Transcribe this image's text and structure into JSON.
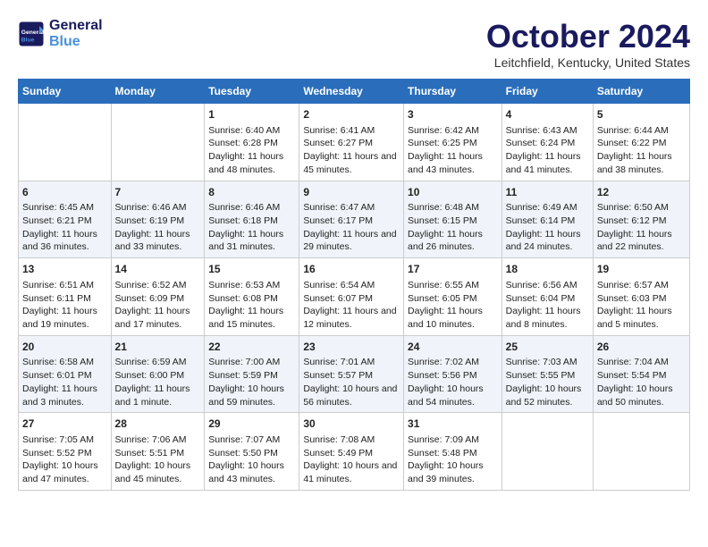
{
  "header": {
    "logo_line1": "General",
    "logo_line2": "Blue",
    "month_title": "October 2024",
    "location": "Leitchfield, Kentucky, United States"
  },
  "days_of_week": [
    "Sunday",
    "Monday",
    "Tuesday",
    "Wednesday",
    "Thursday",
    "Friday",
    "Saturday"
  ],
  "weeks": [
    [
      {
        "day": "",
        "sunrise": "",
        "sunset": "",
        "daylight": ""
      },
      {
        "day": "",
        "sunrise": "",
        "sunset": "",
        "daylight": ""
      },
      {
        "day": "1",
        "sunrise": "Sunrise: 6:40 AM",
        "sunset": "Sunset: 6:28 PM",
        "daylight": "Daylight: 11 hours and 48 minutes."
      },
      {
        "day": "2",
        "sunrise": "Sunrise: 6:41 AM",
        "sunset": "Sunset: 6:27 PM",
        "daylight": "Daylight: 11 hours and 45 minutes."
      },
      {
        "day": "3",
        "sunrise": "Sunrise: 6:42 AM",
        "sunset": "Sunset: 6:25 PM",
        "daylight": "Daylight: 11 hours and 43 minutes."
      },
      {
        "day": "4",
        "sunrise": "Sunrise: 6:43 AM",
        "sunset": "Sunset: 6:24 PM",
        "daylight": "Daylight: 11 hours and 41 minutes."
      },
      {
        "day": "5",
        "sunrise": "Sunrise: 6:44 AM",
        "sunset": "Sunset: 6:22 PM",
        "daylight": "Daylight: 11 hours and 38 minutes."
      }
    ],
    [
      {
        "day": "6",
        "sunrise": "Sunrise: 6:45 AM",
        "sunset": "Sunset: 6:21 PM",
        "daylight": "Daylight: 11 hours and 36 minutes."
      },
      {
        "day": "7",
        "sunrise": "Sunrise: 6:46 AM",
        "sunset": "Sunset: 6:19 PM",
        "daylight": "Daylight: 11 hours and 33 minutes."
      },
      {
        "day": "8",
        "sunrise": "Sunrise: 6:46 AM",
        "sunset": "Sunset: 6:18 PM",
        "daylight": "Daylight: 11 hours and 31 minutes."
      },
      {
        "day": "9",
        "sunrise": "Sunrise: 6:47 AM",
        "sunset": "Sunset: 6:17 PM",
        "daylight": "Daylight: 11 hours and 29 minutes."
      },
      {
        "day": "10",
        "sunrise": "Sunrise: 6:48 AM",
        "sunset": "Sunset: 6:15 PM",
        "daylight": "Daylight: 11 hours and 26 minutes."
      },
      {
        "day": "11",
        "sunrise": "Sunrise: 6:49 AM",
        "sunset": "Sunset: 6:14 PM",
        "daylight": "Daylight: 11 hours and 24 minutes."
      },
      {
        "day": "12",
        "sunrise": "Sunrise: 6:50 AM",
        "sunset": "Sunset: 6:12 PM",
        "daylight": "Daylight: 11 hours and 22 minutes."
      }
    ],
    [
      {
        "day": "13",
        "sunrise": "Sunrise: 6:51 AM",
        "sunset": "Sunset: 6:11 PM",
        "daylight": "Daylight: 11 hours and 19 minutes."
      },
      {
        "day": "14",
        "sunrise": "Sunrise: 6:52 AM",
        "sunset": "Sunset: 6:09 PM",
        "daylight": "Daylight: 11 hours and 17 minutes."
      },
      {
        "day": "15",
        "sunrise": "Sunrise: 6:53 AM",
        "sunset": "Sunset: 6:08 PM",
        "daylight": "Daylight: 11 hours and 15 minutes."
      },
      {
        "day": "16",
        "sunrise": "Sunrise: 6:54 AM",
        "sunset": "Sunset: 6:07 PM",
        "daylight": "Daylight: 11 hours and 12 minutes."
      },
      {
        "day": "17",
        "sunrise": "Sunrise: 6:55 AM",
        "sunset": "Sunset: 6:05 PM",
        "daylight": "Daylight: 11 hours and 10 minutes."
      },
      {
        "day": "18",
        "sunrise": "Sunrise: 6:56 AM",
        "sunset": "Sunset: 6:04 PM",
        "daylight": "Daylight: 11 hours and 8 minutes."
      },
      {
        "day": "19",
        "sunrise": "Sunrise: 6:57 AM",
        "sunset": "Sunset: 6:03 PM",
        "daylight": "Daylight: 11 hours and 5 minutes."
      }
    ],
    [
      {
        "day": "20",
        "sunrise": "Sunrise: 6:58 AM",
        "sunset": "Sunset: 6:01 PM",
        "daylight": "Daylight: 11 hours and 3 minutes."
      },
      {
        "day": "21",
        "sunrise": "Sunrise: 6:59 AM",
        "sunset": "Sunset: 6:00 PM",
        "daylight": "Daylight: 11 hours and 1 minute."
      },
      {
        "day": "22",
        "sunrise": "Sunrise: 7:00 AM",
        "sunset": "Sunset: 5:59 PM",
        "daylight": "Daylight: 10 hours and 59 minutes."
      },
      {
        "day": "23",
        "sunrise": "Sunrise: 7:01 AM",
        "sunset": "Sunset: 5:57 PM",
        "daylight": "Daylight: 10 hours and 56 minutes."
      },
      {
        "day": "24",
        "sunrise": "Sunrise: 7:02 AM",
        "sunset": "Sunset: 5:56 PM",
        "daylight": "Daylight: 10 hours and 54 minutes."
      },
      {
        "day": "25",
        "sunrise": "Sunrise: 7:03 AM",
        "sunset": "Sunset: 5:55 PM",
        "daylight": "Daylight: 10 hours and 52 minutes."
      },
      {
        "day": "26",
        "sunrise": "Sunrise: 7:04 AM",
        "sunset": "Sunset: 5:54 PM",
        "daylight": "Daylight: 10 hours and 50 minutes."
      }
    ],
    [
      {
        "day": "27",
        "sunrise": "Sunrise: 7:05 AM",
        "sunset": "Sunset: 5:52 PM",
        "daylight": "Daylight: 10 hours and 47 minutes."
      },
      {
        "day": "28",
        "sunrise": "Sunrise: 7:06 AM",
        "sunset": "Sunset: 5:51 PM",
        "daylight": "Daylight: 10 hours and 45 minutes."
      },
      {
        "day": "29",
        "sunrise": "Sunrise: 7:07 AM",
        "sunset": "Sunset: 5:50 PM",
        "daylight": "Daylight: 10 hours and 43 minutes."
      },
      {
        "day": "30",
        "sunrise": "Sunrise: 7:08 AM",
        "sunset": "Sunset: 5:49 PM",
        "daylight": "Daylight: 10 hours and 41 minutes."
      },
      {
        "day": "31",
        "sunrise": "Sunrise: 7:09 AM",
        "sunset": "Sunset: 5:48 PM",
        "daylight": "Daylight: 10 hours and 39 minutes."
      },
      {
        "day": "",
        "sunrise": "",
        "sunset": "",
        "daylight": ""
      },
      {
        "day": "",
        "sunrise": "",
        "sunset": "",
        "daylight": ""
      }
    ]
  ]
}
